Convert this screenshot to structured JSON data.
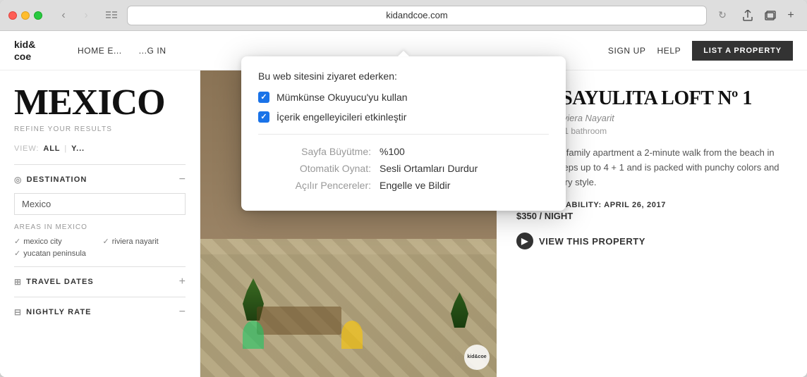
{
  "browser": {
    "address": "kidandcoe.com",
    "back_enabled": true,
    "forward_enabled": false
  },
  "popup": {
    "title": "Bu web sitesini ziyaret ederken:",
    "checkbox1": {
      "label": "Mümkünse Okuyucu'yu kullan",
      "checked": true
    },
    "checkbox2": {
      "label": "İçerik engelleyicileri etkinleştir",
      "checked": true
    },
    "settings": [
      {
        "key": "Sayfa Büyütme:",
        "value": "%100"
      },
      {
        "key": "Otomatik Oynat:",
        "value": "Sesli Ortamları Durdur"
      },
      {
        "key": "Açılır Pencereler:",
        "value": "Engelle ve Bildir"
      }
    ]
  },
  "site": {
    "logo_line1": "kid&",
    "logo_line2": "coe",
    "nav": {
      "item1": "HOME E...",
      "item2": "...G IN",
      "item3": "SIGN UP",
      "item4": "HELP",
      "list_property": "LIST A PROPERTY"
    }
  },
  "sidebar": {
    "page_title": "MEXICO",
    "refine_label": "REFINE YOUR RESULTS",
    "view_label": "VIEW:",
    "view_all": "ALL",
    "view_sep": "|",
    "view_option2": "Y...",
    "destination_section": {
      "title": "DESTINATION",
      "icon": "◎",
      "toggle": "−",
      "input_value": "Mexico"
    },
    "areas": {
      "label": "AREAS IN MEXICO",
      "items": [
        {
          "name": "mexico city",
          "checked": true
        },
        {
          "name": "riviera nayarit",
          "checked": true
        },
        {
          "name": "yucatan peninsula",
          "checked": true
        }
      ]
    },
    "travel_dates": {
      "title": "TRAVEL DATES",
      "icon": "⊞",
      "toggle": "+"
    },
    "nightly_rate": {
      "title": "NIGHTLY RATE",
      "icon": "⊟",
      "toggle": "−"
    }
  },
  "property": {
    "title": "THE SAYULITA LOFT Nº 1",
    "location": "Sayulita, Riviera Nayarit",
    "specs": "1 bedroom / 1 bathroom",
    "description": "This vibrant family apartment a 2-minute walk from the beach in Sayulita sleeps up to 4 + 1 and is packed with punchy colors and contemporary style.",
    "availability_label": "NEXT AVAILABILITY: APRIL 26, 2017",
    "price": "$350 / NIGHT",
    "view_btn": "VIEW THIS PROPERTY",
    "watermark_line1": "kid&",
    "watermark_line2": "coe"
  }
}
